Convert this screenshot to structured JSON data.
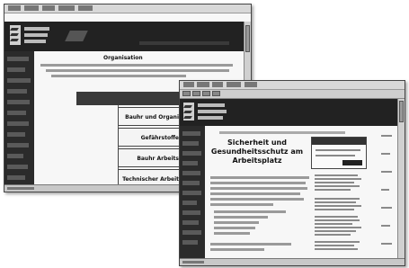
{
  "back_window": {
    "page_title": "Organisation",
    "nav_items": [
      {
        "label": "Bauhr und Organi"
      },
      {
        "label": "Gefährstoffe"
      },
      {
        "label": "Bauhr Arbeits"
      },
      {
        "label": "Technischer Arbeit"
      }
    ]
  },
  "front_window": {
    "heading_line1": "Sicherheit und",
    "heading_line2": "Gesundheitsschutz am",
    "heading_line3": "Arbeitsplatz"
  },
  "colors": {
    "sidebar": "#2b2b2b",
    "banner": "#222222",
    "window_bg": "#f7f7f7",
    "nav_header": "#3a3a3a"
  }
}
